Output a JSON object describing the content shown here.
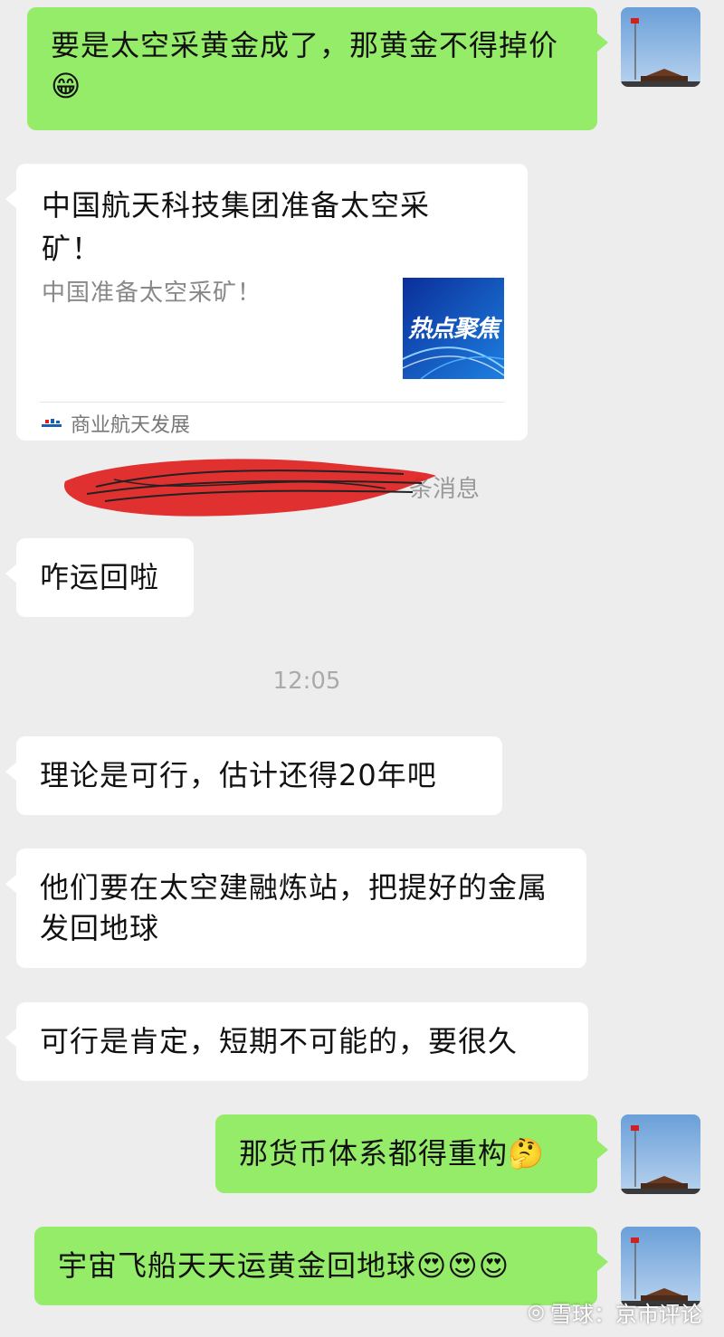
{
  "messages": [
    {
      "from": "me",
      "text": "要是太空采黄金成了，那黄金不得掉价",
      "emoji": "😁"
    },
    {
      "from": "them",
      "type": "card",
      "title": "中国航天科技集团准备太空采矿！",
      "description": "中国准备太空采矿！",
      "thumb_text": "热点聚焦",
      "source": "商业航天发展"
    },
    {
      "from": "system",
      "text": "条消息"
    },
    {
      "from": "them",
      "text": "咋运回啦"
    },
    {
      "from": "them",
      "text": "理论是可行，估计还得20年吧"
    },
    {
      "from": "them",
      "text": "他们要在太空建融炼站，把提好的金属发回地球"
    },
    {
      "from": "them",
      "text": "可行是肯定，短期不可能的，要很久"
    },
    {
      "from": "me",
      "text": "那货币体系都得重构",
      "emoji": "🤔"
    },
    {
      "from": "me",
      "text": "宇宙飞船天天运黄金回地球",
      "emoji": "😍😍😍"
    }
  ],
  "timestamp": "12:05",
  "watermark": {
    "icon": "◎",
    "text": "雪球：京市评论"
  },
  "avatar": {
    "icon": "tiananmen-flag-avatar"
  },
  "colors": {
    "background": "#ededed",
    "my_bubble": "#95ec69",
    "their_bubble": "#ffffff",
    "redaction": "#e02020"
  }
}
